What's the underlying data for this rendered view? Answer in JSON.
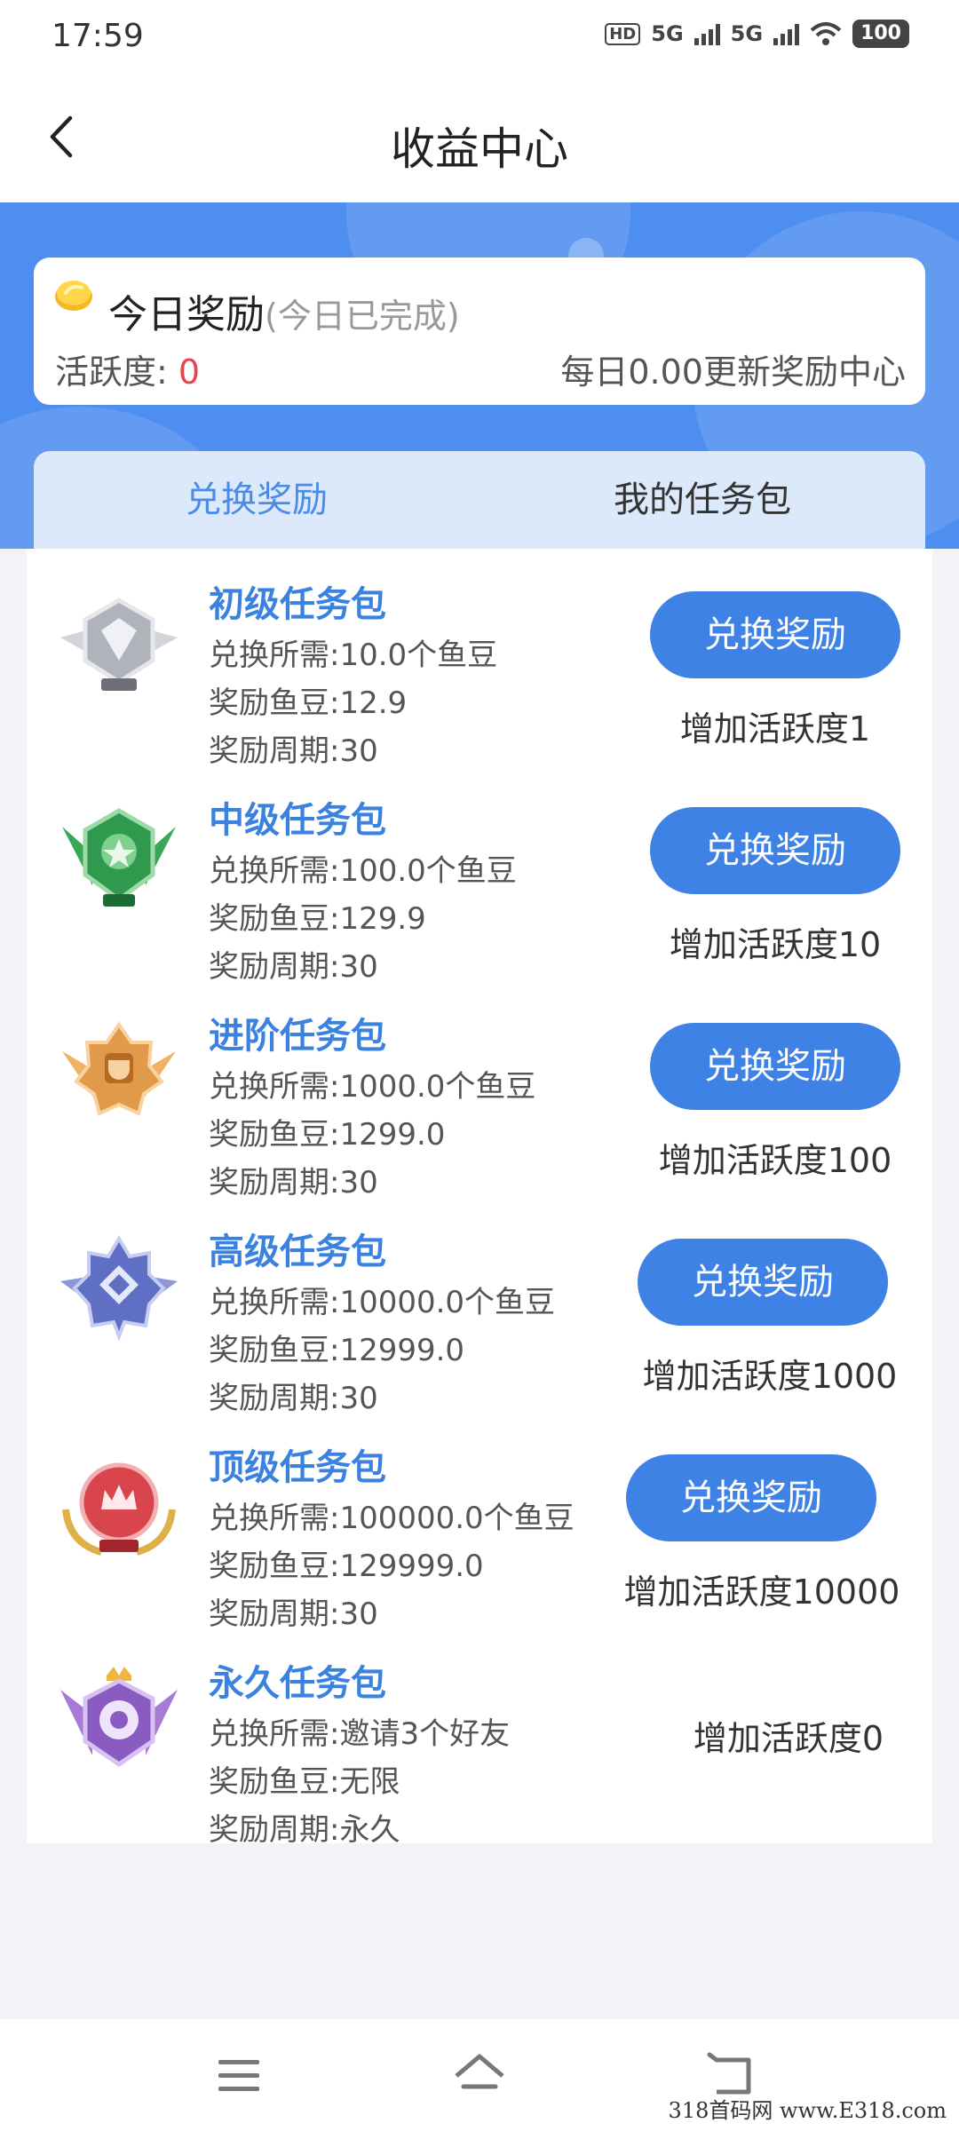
{
  "status": {
    "time": "17:59",
    "network": "5G",
    "battery": "100"
  },
  "header": {
    "title": "收益中心"
  },
  "reward": {
    "title": "今日奖励",
    "subtitle": "(今日已完成)",
    "activity_label": "活跃度: ",
    "activity_value": "0",
    "update_note": "每日0.00更新奖励中心"
  },
  "tabs": [
    {
      "label": "兑换奖励"
    },
    {
      "label": "我的任务包"
    }
  ],
  "items": [
    {
      "title": "初级任务包",
      "cost": "兑换所需:10.0个鱼豆",
      "reward": "奖励鱼豆:12.9",
      "period": "奖励周期:30",
      "button": "兑换奖励",
      "gain": "增加活跃度1",
      "badge_color": "#b9bcc4"
    },
    {
      "title": "中级任务包",
      "cost": "兑换所需:100.0个鱼豆",
      "reward": "奖励鱼豆:129.9",
      "period": "奖励周期:30",
      "button": "兑换奖励",
      "gain": "增加活跃度10",
      "badge_color": "#2f9a4e"
    },
    {
      "title": "进阶任务包",
      "cost": "兑换所需:1000.0个鱼豆",
      "reward": "奖励鱼豆:1299.0",
      "period": "奖励周期:30",
      "button": "兑换奖励",
      "gain": "增加活跃度100",
      "badge_color": "#e09a4a"
    },
    {
      "title": "高级任务包",
      "cost": "兑换所需:10000.0个鱼豆",
      "reward": "奖励鱼豆:12999.0",
      "period": "奖励周期:30",
      "button": "兑换奖励",
      "gain": "增加活跃度1000",
      "badge_color": "#5f6fc4"
    },
    {
      "title": "顶级任务包",
      "cost": "兑换所需:100000.0个鱼豆",
      "reward": "奖励鱼豆:129999.0",
      "period": "奖励周期:30",
      "button": "兑换奖励",
      "gain": "增加活跃度10000",
      "badge_color": "#d8454d"
    },
    {
      "title": "永久任务包",
      "cost": "兑换所需:邀请3个好友",
      "reward": "奖励鱼豆:无限",
      "period": "奖励周期:永久",
      "button": "",
      "gain": "增加活跃度0",
      "badge_color": "#8a5bc0"
    }
  ],
  "watermark": "318首码网 www.E318.com"
}
